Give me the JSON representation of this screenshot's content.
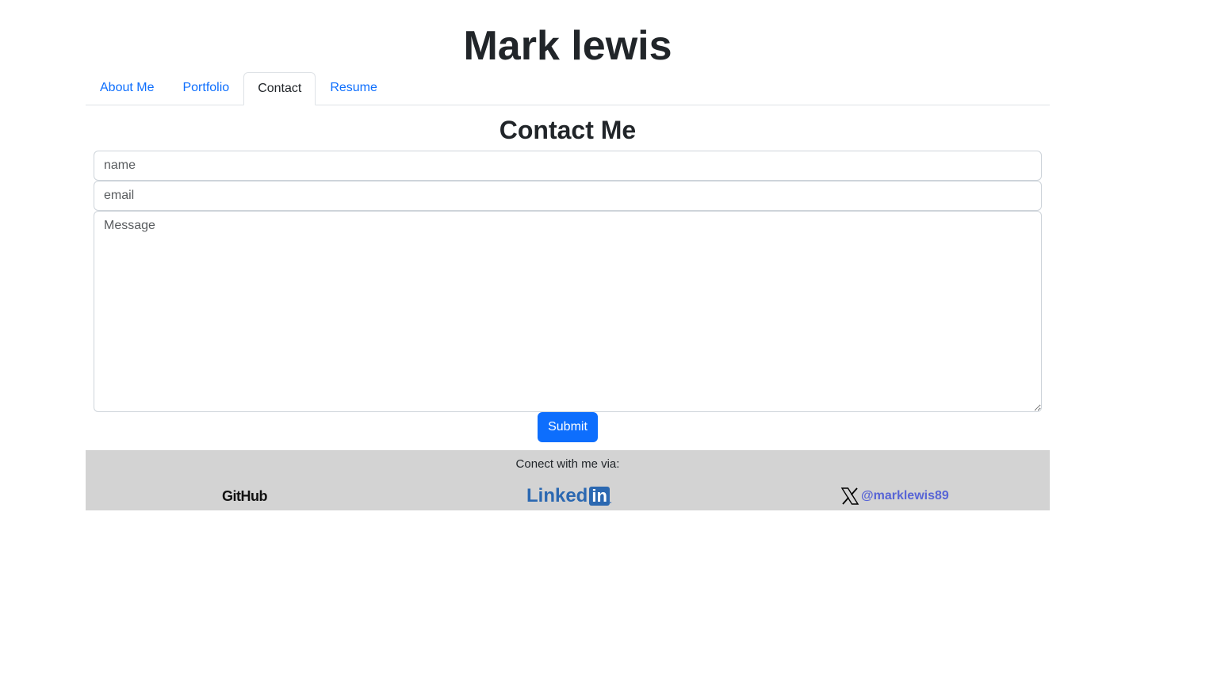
{
  "site": {
    "title": "Mark lewis"
  },
  "nav": {
    "tabs": [
      {
        "label": "About Me",
        "active": false
      },
      {
        "label": "Portfolio",
        "active": false
      },
      {
        "label": "Contact",
        "active": true
      },
      {
        "label": "Resume",
        "active": false
      }
    ]
  },
  "contact": {
    "heading": "Contact Me",
    "name_placeholder": "name",
    "email_placeholder": "email",
    "message_placeholder": "Message",
    "submit_label": "Submit"
  },
  "footer": {
    "text": "Conect with me via:",
    "github_logo": "GitHub",
    "linkedin_logo_left": "Linked",
    "linkedin_logo_box": "in",
    "linkedin_logo_dot": ".",
    "twitter_handle": "@marklewis89"
  },
  "colors": {
    "link": "#0d6efd",
    "button": "#0d6efd",
    "footer_bg": "#d3d3d3",
    "linkedin": "#2b68b1",
    "twitter_handle": "#5865d6"
  }
}
